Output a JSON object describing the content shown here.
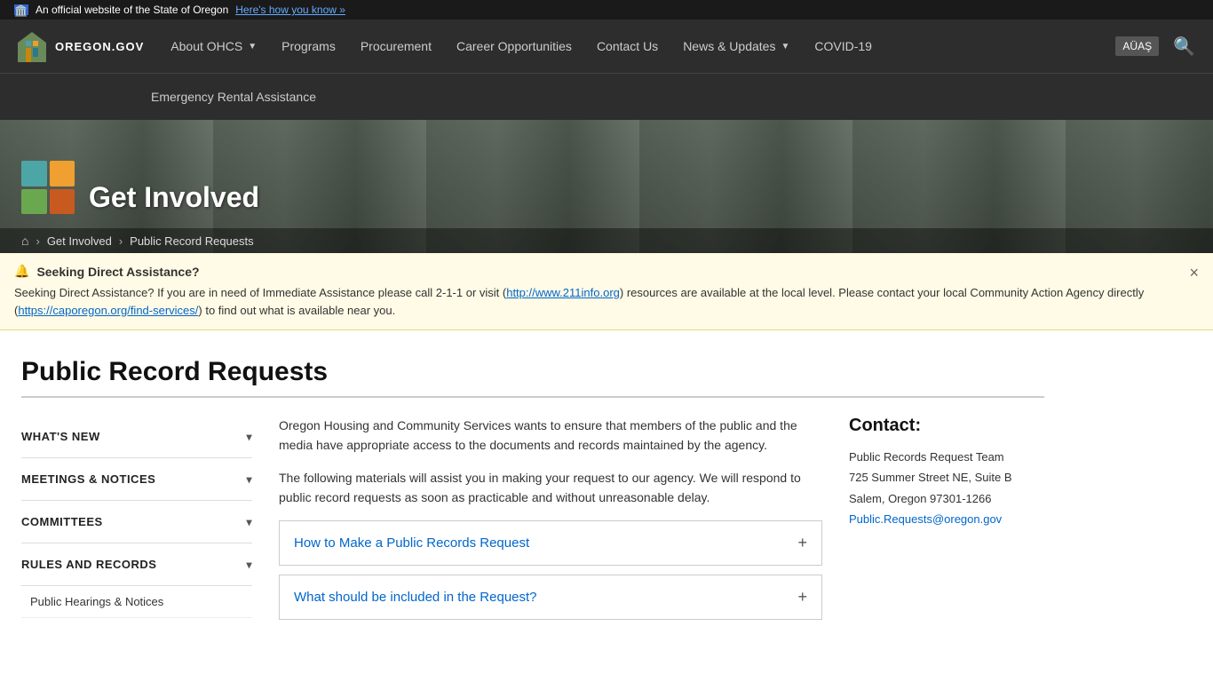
{
  "topbar": {
    "official_text": "An official website of the State of Oregon",
    "how_to_know": "Here's how you know »"
  },
  "nav": {
    "logo_text": "OREGON.GOV",
    "items": [
      {
        "label": "About OHCS",
        "has_dropdown": true
      },
      {
        "label": "Programs",
        "has_dropdown": false
      },
      {
        "label": "Procurement",
        "has_dropdown": false
      },
      {
        "label": "Career Opportunities",
        "has_dropdown": false
      },
      {
        "label": "Contact Us",
        "has_dropdown": false
      },
      {
        "label": "News & Updates",
        "has_dropdown": true
      },
      {
        "label": "COVID-19",
        "has_dropdown": false
      }
    ],
    "emergency_link": "Emergency Rental Assistance",
    "translate_label": "AÜAŞ"
  },
  "hero": {
    "title": "Get Involved",
    "logo_cells": [
      "#4da6a6",
      "#f0a030",
      "#6aa84f",
      "#c85a20"
    ]
  },
  "breadcrumb": {
    "home_icon": "⌂",
    "items": [
      {
        "label": "Get Involved"
      },
      {
        "label": "Public Record Requests"
      }
    ]
  },
  "alert": {
    "title": "Seeking Direct Assistance?",
    "bell": "🔔",
    "text_before": "Seeking Direct Assistance? If you are in need of Immediate Assistance please call 2-1-1 or visit (",
    "link1_text": "http://www.211info.org",
    "link1_url": "http://www.211info.org",
    "text_middle": ") resources are available at the local level. Please contact your local Community Action Agency directly (",
    "link2_text": "https://caporegon.org/find-services/",
    "link2_url": "https://caporegon.org/find-services/",
    "text_after": ") to find out what is available near you.",
    "close_label": "×"
  },
  "page": {
    "title": "Public Record Requests"
  },
  "sidebar": {
    "items": [
      {
        "label": "WHAT'S NEW"
      },
      {
        "label": "MEETINGS & NOTICES"
      },
      {
        "label": "COMMITTEES"
      },
      {
        "label": "RULES AND RECORDS"
      }
    ],
    "sub_items": [
      {
        "label": "Public Hearings & Notices"
      }
    ]
  },
  "article": {
    "paragraph1": "Oregon Housing and Community Services wants to ensure that members of the public and the media have appropriate access to the documents and records maintained by the agency.",
    "paragraph2": "The following materials will assist you in making your request to our agency. We will respond to public record requests as soon as practicable and without unreasonable delay.",
    "accordions": [
      {
        "title": "How to Make a Public Records Request"
      },
      {
        "title": "What should be included in the Request?"
      }
    ]
  },
  "contact": {
    "title": "Contact:",
    "team": "Public Records Request Team",
    "address1": "725 Summer Street NE, Suite B",
    "address2": "Salem, Oregon 97301-1266",
    "email_text": "Public.Requests@oregon.gov",
    "email_url": "mailto:Public.Requests@oregon.gov"
  }
}
